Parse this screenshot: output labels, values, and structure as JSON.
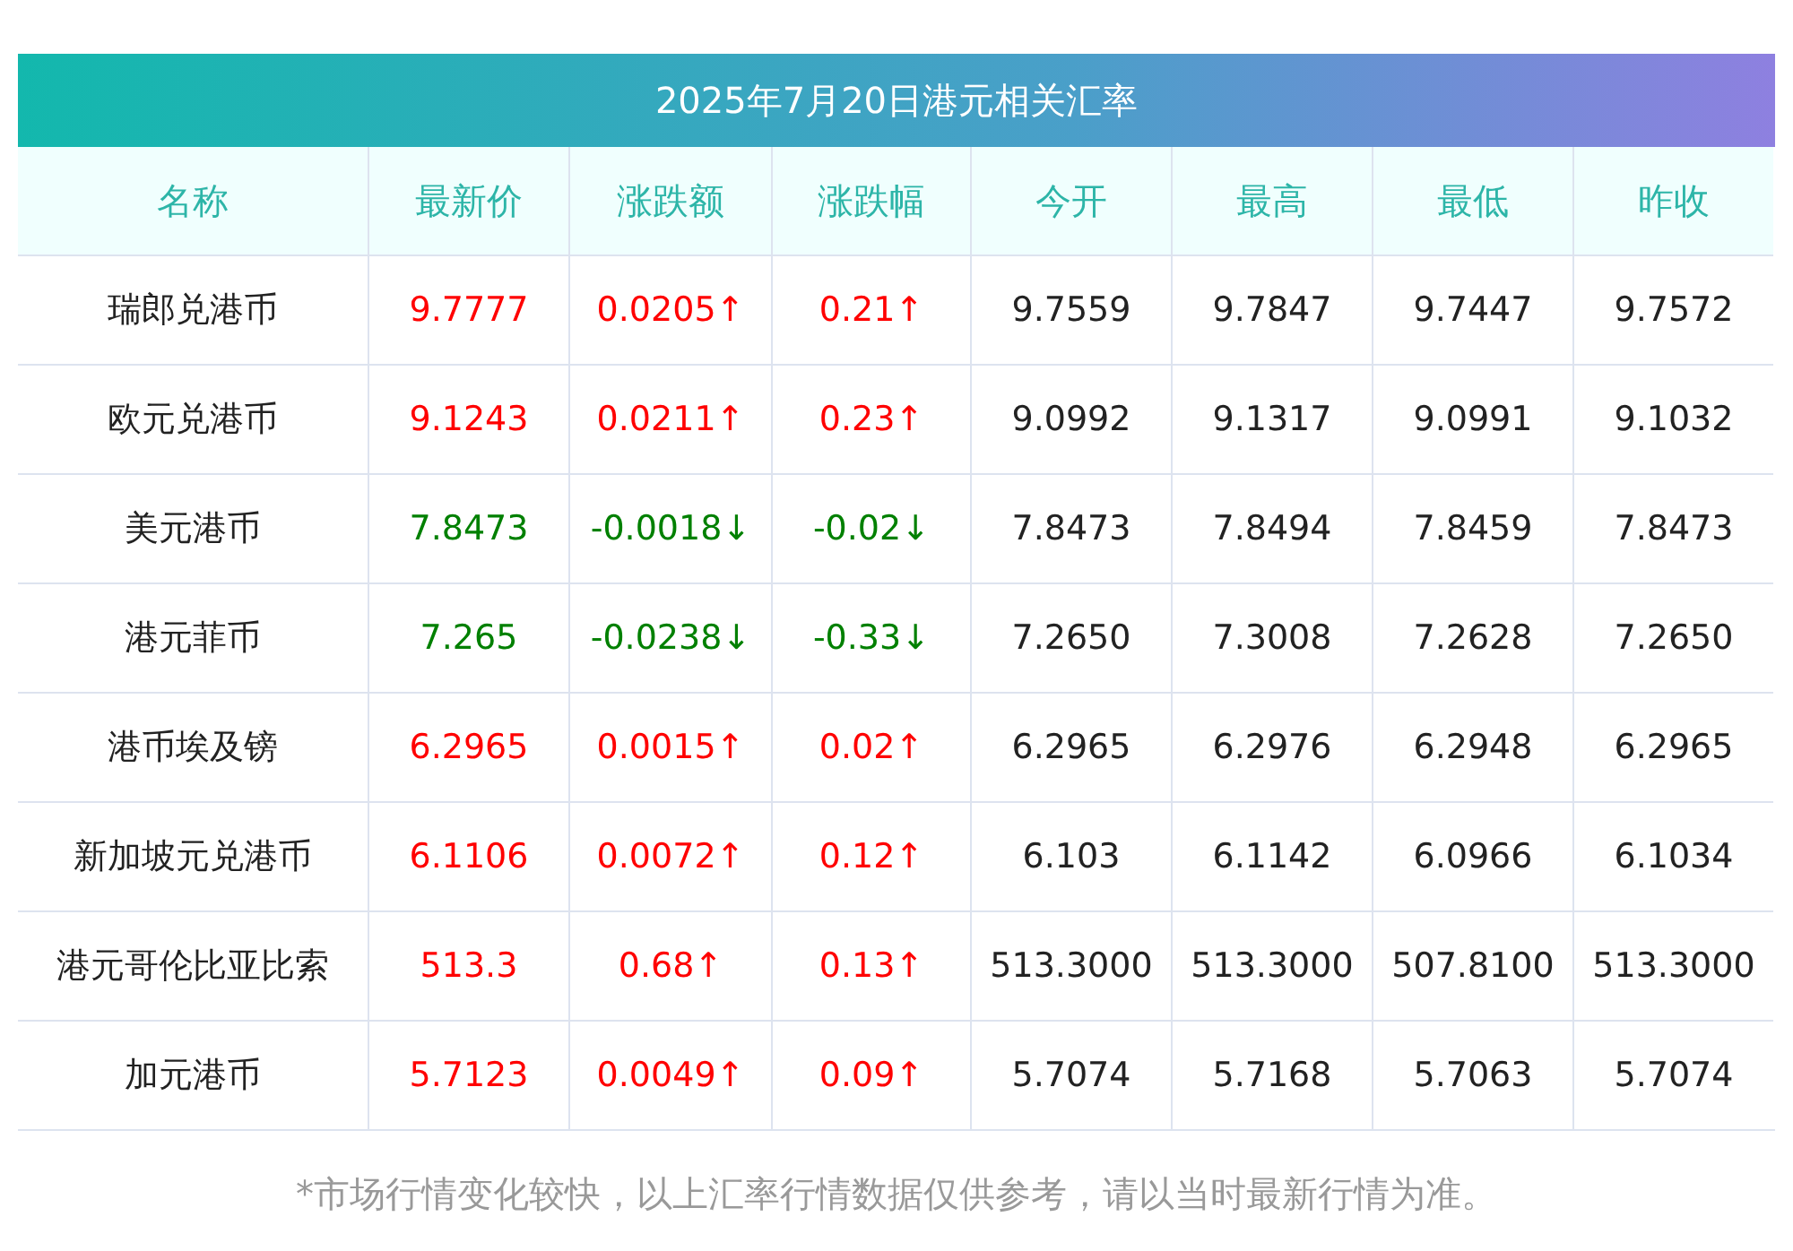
{
  "title": "2025年7月20日港元相关汇率",
  "columns": [
    "名称",
    "最新价",
    "涨跌额",
    "涨跌幅",
    "今开",
    "最高",
    "最低",
    "昨收"
  ],
  "rows": [
    {
      "name": "瑞郎兑港币",
      "color": "#ff0000",
      "latest": "9.7777",
      "change": "0.0205↑",
      "pct": "0.21↑",
      "open": "9.7559",
      "high": "9.7847",
      "low": "9.7447",
      "prev": "9.7572"
    },
    {
      "name": "欧元兑港币",
      "color": "#ff0000",
      "latest": "9.1243",
      "change": "0.0211↑",
      "pct": "0.23↑",
      "open": "9.0992",
      "high": "9.1317",
      "low": "9.0991",
      "prev": "9.1032"
    },
    {
      "name": "美元港币",
      "color": "#008000",
      "latest": "7.8473",
      "change": "-0.0018↓",
      "pct": "-0.02↓",
      "open": "7.8473",
      "high": "7.8494",
      "low": "7.8459",
      "prev": "7.8473"
    },
    {
      "name": "港元菲币",
      "color": "#008000",
      "latest": "7.265",
      "change": "-0.0238↓",
      "pct": "-0.33↓",
      "open": "7.2650",
      "high": "7.3008",
      "low": "7.2628",
      "prev": "7.2650"
    },
    {
      "name": "港币埃及镑",
      "color": "#ff0000",
      "latest": "6.2965",
      "change": "0.0015↑",
      "pct": "0.02↑",
      "open": "6.2965",
      "high": "6.2976",
      "low": "6.2948",
      "prev": "6.2965"
    },
    {
      "name": "新加坡元兑港币",
      "color": "#ff0000",
      "latest": "6.1106",
      "change": "0.0072↑",
      "pct": "0.12↑",
      "open": "6.103",
      "high": "6.1142",
      "low": "6.0966",
      "prev": "6.1034"
    },
    {
      "name": "港元哥伦比亚比索",
      "color": "#ff0000",
      "latest": "513.3",
      "change": "0.68↑",
      "pct": "0.13↑",
      "open": "513.3000",
      "high": "513.3000",
      "low": "507.8100",
      "prev": "513.3000"
    },
    {
      "name": "加元港币",
      "color": "#ff0000",
      "latest": "5.7123",
      "change": "0.0049↑",
      "pct": "0.09↑",
      "open": "5.7074",
      "high": "5.7168",
      "low": "5.7063",
      "prev": "5.7074"
    }
  ],
  "footnote": "*市场行情变化较快，以上汇率行情数据仅供参考，请以当时最新行情为准。"
}
